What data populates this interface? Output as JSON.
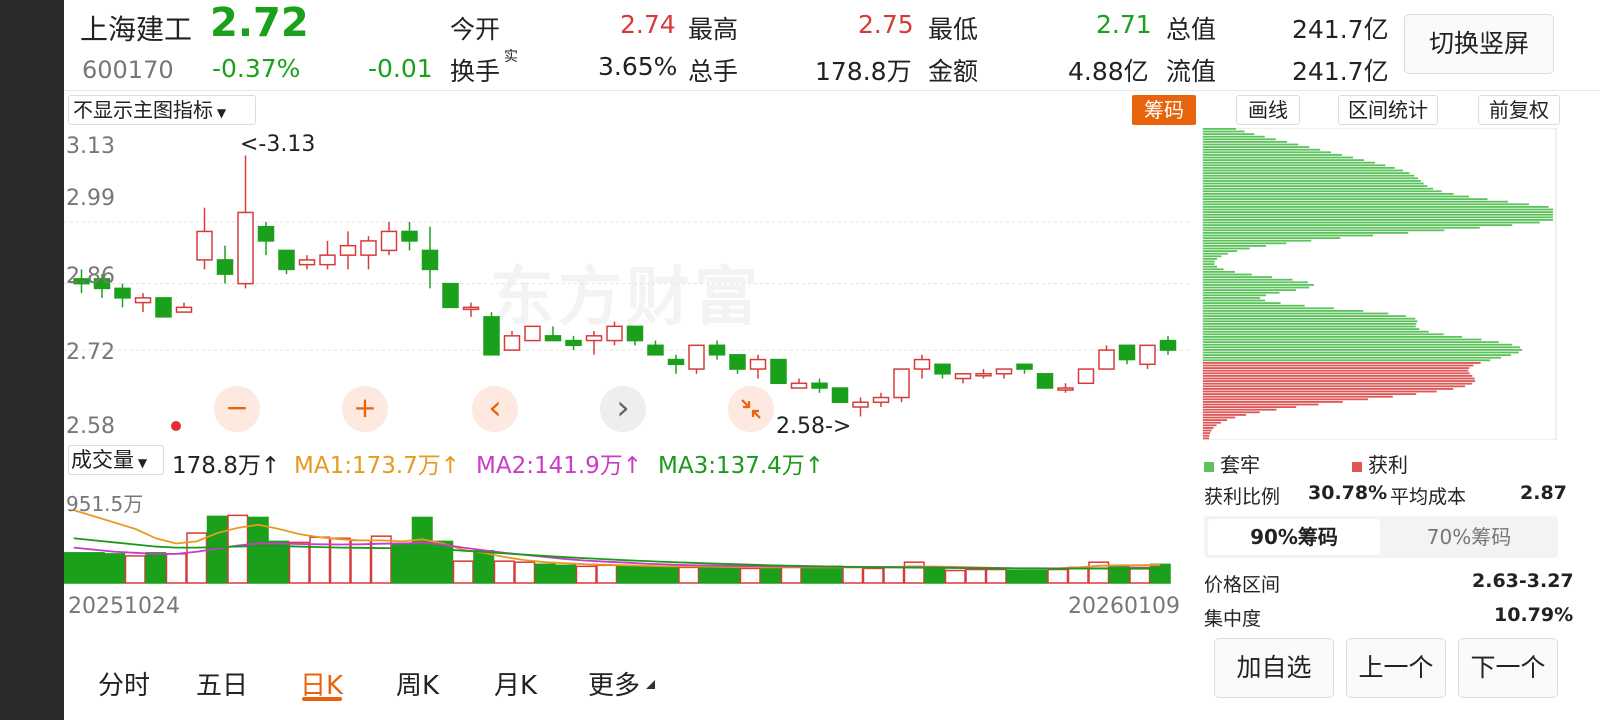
{
  "stock": {
    "name": "上海建工",
    "price": "2.72",
    "code": "600170",
    "change_pct": "-0.37%",
    "change": "-0.01"
  },
  "quote": {
    "open_label": "今开",
    "open_value": "2.74",
    "high_label": "最高",
    "high_value": "2.75",
    "low_label": "最低",
    "low_value": "2.71",
    "mktcap_label": "总值",
    "mktcap_value": "241.7亿",
    "turnover_label": "换手",
    "turnover_sup": "实",
    "turnover_value": "3.65%",
    "volume_label": "总手",
    "volume_value": "178.8万",
    "amount_label": "金额",
    "amount_value": "4.88亿",
    "float_label": "流值",
    "float_value": "241.7亿"
  },
  "toolbar": {
    "switch_label": "切换竖屏",
    "indicator_select": "不显示主图指标",
    "chip_label": "筹码",
    "draw_label": "画线",
    "range_label": "区间统计",
    "adjust_label": "前复权"
  },
  "main_chart": {
    "y_ticks": [
      "3.13",
      "2.99",
      "2.86",
      "2.72",
      "2.58"
    ],
    "high_marker": "<-3.13",
    "low_marker": "2.58->",
    "watermark": "东方财富",
    "controls": {
      "zoom_out": "−",
      "zoom_in": "+",
      "prev": "‹",
      "next": "›"
    }
  },
  "volume_chart": {
    "select_label": "成交量",
    "current": "178.8万↑",
    "ma1": "MA1:173.7万↑",
    "ma2": "MA2:141.9万↑",
    "ma3": "MA3:137.4万↑",
    "max_label": "951.5万",
    "ma_colors": {
      "ma1": "#e89a1e",
      "ma2": "#c83cc8",
      "ma3": "#1a9a1a"
    },
    "date_start": "20251024",
    "date_end": "20260109"
  },
  "chip_panel": {
    "legend_trapped": "套牢",
    "legend_profit": "获利",
    "profit_ratio_label": "获利比例",
    "profit_ratio_value": "30.78%",
    "avg_cost_label": "平均成本",
    "avg_cost_value": "2.87",
    "tab_90": "90%筹码",
    "tab_70": "70%筹码",
    "price_range_label": "价格区间",
    "price_range_value": "2.63-3.27",
    "concentration_label": "集中度",
    "concentration_value": "10.79%"
  },
  "period_tabs": [
    "分时",
    "五日",
    "日K",
    "周K",
    "月K",
    "更多"
  ],
  "active_tab": "日K",
  "actions": {
    "add_watch": "加自选",
    "prev": "上一个",
    "next": "下一个"
  },
  "colors": {
    "up": "#d83a3a",
    "down": "#1aa01a",
    "accent": "#e8640c"
  },
  "chart_data": {
    "type": "candlestick",
    "y_range": [
      2.56,
      3.15
    ],
    "candles": [
      {
        "o": 2.87,
        "c": 2.86,
        "h": 2.89,
        "l": 2.84
      },
      {
        "o": 2.87,
        "c": 2.85,
        "h": 2.88,
        "l": 2.83
      },
      {
        "o": 2.85,
        "c": 2.83,
        "h": 2.86,
        "l": 2.81
      },
      {
        "o": 2.82,
        "c": 2.83,
        "h": 2.84,
        "l": 2.8
      },
      {
        "o": 2.83,
        "c": 2.79,
        "h": 2.83,
        "l": 2.79
      },
      {
        "o": 2.8,
        "c": 2.81,
        "h": 2.82,
        "l": 2.8
      },
      {
        "o": 2.91,
        "c": 2.97,
        "h": 3.02,
        "l": 2.89
      },
      {
        "o": 2.91,
        "c": 2.88,
        "h": 2.94,
        "l": 2.86
      },
      {
        "o": 2.86,
        "c": 3.01,
        "h": 3.13,
        "l": 2.85
      },
      {
        "o": 2.98,
        "c": 2.95,
        "h": 2.99,
        "l": 2.92
      },
      {
        "o": 2.93,
        "c": 2.89,
        "h": 2.93,
        "l": 2.88
      },
      {
        "o": 2.9,
        "c": 2.91,
        "h": 2.92,
        "l": 2.89
      },
      {
        "o": 2.9,
        "c": 2.92,
        "h": 2.95,
        "l": 2.89
      },
      {
        "o": 2.92,
        "c": 2.94,
        "h": 2.97,
        "l": 2.89
      },
      {
        "o": 2.92,
        "c": 2.95,
        "h": 2.96,
        "l": 2.89
      },
      {
        "o": 2.93,
        "c": 2.97,
        "h": 2.99,
        "l": 2.92
      },
      {
        "o": 2.97,
        "c": 2.95,
        "h": 2.99,
        "l": 2.93
      },
      {
        "o": 2.93,
        "c": 2.89,
        "h": 2.98,
        "l": 2.85
      },
      {
        "o": 2.86,
        "c": 2.81,
        "h": 2.86,
        "l": 2.81
      },
      {
        "o": 2.81,
        "c": 2.81,
        "h": 2.82,
        "l": 2.79
      },
      {
        "o": 2.79,
        "c": 2.71,
        "h": 2.8,
        "l": 2.71
      },
      {
        "o": 2.72,
        "c": 2.75,
        "h": 2.76,
        "l": 2.72
      },
      {
        "o": 2.74,
        "c": 2.77,
        "h": 2.77,
        "l": 2.74
      },
      {
        "o": 2.75,
        "c": 2.74,
        "h": 2.77,
        "l": 2.74
      },
      {
        "o": 2.74,
        "c": 2.73,
        "h": 2.75,
        "l": 2.72
      },
      {
        "o": 2.74,
        "c": 2.75,
        "h": 2.76,
        "l": 2.71
      },
      {
        "o": 2.74,
        "c": 2.77,
        "h": 2.78,
        "l": 2.73
      },
      {
        "o": 2.77,
        "c": 2.74,
        "h": 2.77,
        "l": 2.73
      },
      {
        "o": 2.73,
        "c": 2.71,
        "h": 2.74,
        "l": 2.71
      },
      {
        "o": 2.7,
        "c": 2.69,
        "h": 2.71,
        "l": 2.67
      },
      {
        "o": 2.68,
        "c": 2.73,
        "h": 2.73,
        "l": 2.67
      },
      {
        "o": 2.73,
        "c": 2.71,
        "h": 2.74,
        "l": 2.7
      },
      {
        "o": 2.71,
        "c": 2.68,
        "h": 2.71,
        "l": 2.67
      },
      {
        "o": 2.68,
        "c": 2.7,
        "h": 2.71,
        "l": 2.66
      },
      {
        "o": 2.7,
        "c": 2.65,
        "h": 2.7,
        "l": 2.65
      },
      {
        "o": 2.64,
        "c": 2.65,
        "h": 2.66,
        "l": 2.64
      },
      {
        "o": 2.65,
        "c": 2.64,
        "h": 2.66,
        "l": 2.63
      },
      {
        "o": 2.64,
        "c": 2.61,
        "h": 2.64,
        "l": 2.61
      },
      {
        "o": 2.6,
        "c": 2.61,
        "h": 2.62,
        "l": 2.58
      },
      {
        "o": 2.61,
        "c": 2.62,
        "h": 2.63,
        "l": 2.6
      },
      {
        "o": 2.62,
        "c": 2.68,
        "h": 2.68,
        "l": 2.61
      },
      {
        "o": 2.68,
        "c": 2.7,
        "h": 2.71,
        "l": 2.66
      },
      {
        "o": 2.69,
        "c": 2.67,
        "h": 2.69,
        "l": 2.66
      },
      {
        "o": 2.66,
        "c": 2.67,
        "h": 2.67,
        "l": 2.65
      },
      {
        "o": 2.67,
        "c": 2.67,
        "h": 2.68,
        "l": 2.66
      },
      {
        "o": 2.67,
        "c": 2.68,
        "h": 2.68,
        "l": 2.66
      },
      {
        "o": 2.69,
        "c": 2.68,
        "h": 2.69,
        "l": 2.67
      },
      {
        "o": 2.67,
        "c": 2.64,
        "h": 2.67,
        "l": 2.64
      },
      {
        "o": 2.64,
        "c": 2.64,
        "h": 2.65,
        "l": 2.63
      },
      {
        "o": 2.65,
        "c": 2.68,
        "h": 2.68,
        "l": 2.65
      },
      {
        "o": 2.68,
        "c": 2.72,
        "h": 2.73,
        "l": 2.68
      },
      {
        "o": 2.73,
        "c": 2.7,
        "h": 2.73,
        "l": 2.69
      },
      {
        "o": 2.69,
        "c": 2.73,
        "h": 2.73,
        "l": 2.68
      },
      {
        "o": 2.74,
        "c": 2.72,
        "h": 2.75,
        "l": 2.71
      }
    ],
    "volume_max": 951.5,
    "volumes": [
      290,
      290,
      280,
      260,
      290,
      280,
      480,
      640,
      650,
      630,
      400,
      390,
      440,
      430,
      410,
      450,
      380,
      630,
      400,
      210,
      310,
      210,
      200,
      180,
      170,
      160,
      170,
      160,
      160,
      150,
      150,
      150,
      150,
      140,
      150,
      150,
      140,
      160,
      150,
      140,
      150,
      200,
      140,
      120,
      130,
      130,
      120,
      120,
      130,
      150,
      200,
      170,
      150,
      179
    ],
    "ma1": [
      700,
      640,
      580,
      520,
      430,
      380,
      400,
      480,
      530,
      560,
      520,
      470,
      440,
      420,
      410,
      410,
      400,
      420,
      380,
      320,
      290,
      250,
      220,
      200,
      190,
      180,
      175,
      170,
      165,
      160,
      160,
      158,
      155,
      152,
      150,
      150,
      150,
      150,
      150,
      152,
      155,
      160,
      158,
      155,
      150,
      145,
      140,
      138,
      140,
      150,
      165,
      170,
      172,
      173.7
    ],
    "ma2": [
      340,
      320,
      300,
      290,
      280,
      280,
      300,
      330,
      360,
      380,
      380,
      375,
      372,
      370,
      372,
      378,
      380,
      390,
      370,
      340,
      315,
      290,
      270,
      250,
      230,
      215,
      205,
      195,
      185,
      178,
      172,
      168,
      165,
      162,
      160,
      158,
      156,
      155,
      154,
      153,
      152,
      152,
      150,
      148,
      146,
      144,
      142,
      141,
      140,
      140,
      141,
      141.5,
      141.7,
      141.9
    ],
    "ma3": [
      430,
      410,
      390,
      370,
      350,
      340,
      340,
      345,
      350,
      355,
      355,
      350,
      345,
      340,
      338,
      336,
      334,
      333,
      325,
      310,
      298,
      285,
      272,
      260,
      248,
      238,
      228,
      218,
      210,
      202,
      195,
      188,
      182,
      176,
      170,
      166,
      162,
      158,
      155,
      152,
      150,
      148,
      146,
      144,
      142,
      141,
      140,
      139,
      138,
      138,
      138,
      137.6,
      137.5,
      137.4
    ],
    "chip_distribution": {
      "price_range": [
        2.58,
        3.13
      ],
      "bins": 120,
      "split_price": 2.72
    }
  }
}
